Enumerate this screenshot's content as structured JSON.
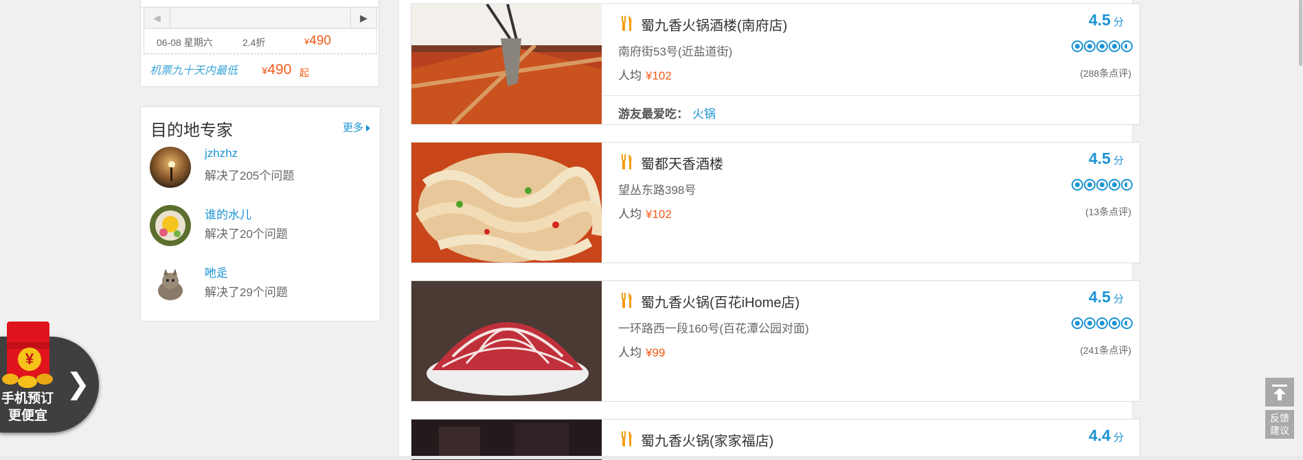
{
  "flight": {
    "date": "06-08 星期六",
    "discount": "2.4折",
    "price_symbol": "¥",
    "price": "490",
    "promo_text": "机票九十天内最低",
    "promo_price_symbol": "¥",
    "promo_price": "490",
    "promo_suffix": "起"
  },
  "experts": {
    "title": "目的地专家",
    "more_label": "更多",
    "items": [
      {
        "name": "jzhzhz",
        "solved": "解决了205个问题"
      },
      {
        "name": "谁的水儿",
        "solved": "解决了20个问题"
      },
      {
        "name": "吔辵",
        "solved": "解决了29个问题"
      }
    ]
  },
  "restaurants": [
    {
      "name": "蜀九香火锅酒楼(南府店)",
      "address": "南府街53号(近盐道街)",
      "avg_label": "人均",
      "price": "¥102",
      "score": "4.5",
      "score_unit": "分",
      "rating": 4.5,
      "reviews": "(288条点评)",
      "fav_label": "游友最爱吃：",
      "fav_value": "火锅"
    },
    {
      "name": "蜀都天香酒楼",
      "address": "望丛东路398号",
      "avg_label": "人均",
      "price": "¥102",
      "score": "4.5",
      "score_unit": "分",
      "rating": 4.5,
      "reviews": "(13条点评)"
    },
    {
      "name": "蜀九香火锅(百花iHome店)",
      "address": "一环路西一段160号(百花潭公园对面)",
      "avg_label": "人均",
      "price": "¥99",
      "score": "4.5",
      "score_unit": "分",
      "rating": 4.5,
      "reviews": "(241条点评)"
    },
    {
      "name": "蜀九香火锅(家家福店)",
      "score": "4.4",
      "score_unit": "分"
    }
  ],
  "promo_widget": {
    "yen": "¥",
    "line1": "手机预订",
    "line2": "更便宜"
  },
  "side": {
    "feedback_line1": "反馈",
    "feedback_line2": "建议"
  },
  "colors": {
    "accent_blue": "#1b93d4",
    "price_orange": "#f25a16"
  }
}
